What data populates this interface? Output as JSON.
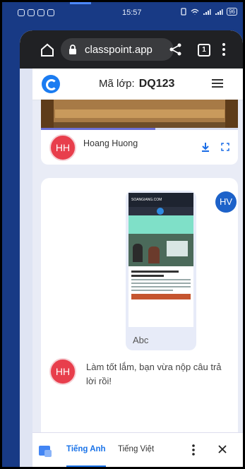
{
  "status_bar": {
    "time": "15:57",
    "battery": "96"
  },
  "browser": {
    "url": "classpoint.app",
    "tab_count": "1"
  },
  "app_header": {
    "class_code_label": "Mã lớp:",
    "class_code": "DQ123"
  },
  "submission_1": {
    "avatar_initials": "HH",
    "student_name": "Hoang Huong",
    "progress_fraction": 0.58
  },
  "submission_2": {
    "teacher_initials": "HV",
    "thumbnail": {
      "site_name": "SOANGIANG.COM",
      "caption": "Abc"
    },
    "reply": {
      "avatar_initials": "HH",
      "message": "Làm tốt lắm, bạn vừa nộp câu trả lời rồi!"
    }
  },
  "translate_bar": {
    "tab_english": "Tiếng Anh",
    "tab_vietnamese": "Tiếng Việt"
  },
  "colors": {
    "frame": "#183a85",
    "accent": "#1a73e8",
    "avatar_red": "#e83e4c",
    "avatar_blue": "#1d62c9"
  }
}
